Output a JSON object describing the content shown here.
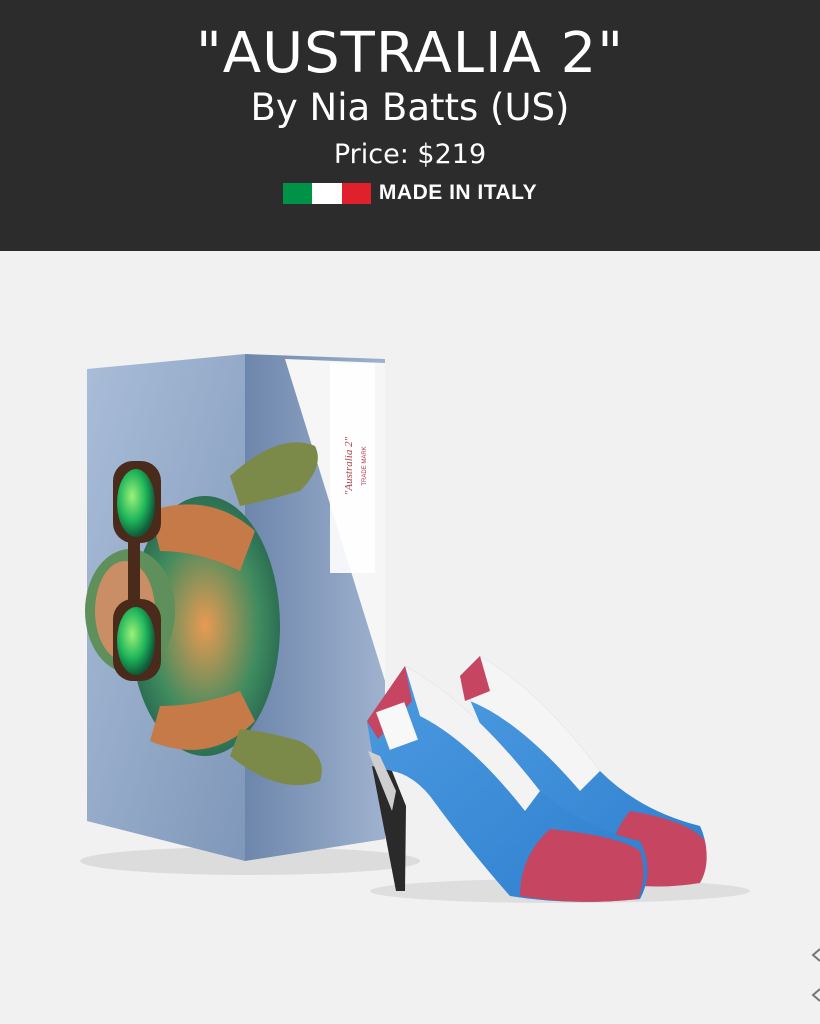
{
  "header": {
    "title": "\"AUSTRALIA 2\"",
    "designer": "By Nia Batts (US)",
    "price": "Price: $219",
    "made_in": "MADE IN ITALY",
    "flag_colors": [
      "#009246",
      "#ffffff",
      "#e0202a"
    ]
  },
  "colors": {
    "header_bg": "#2c2c2c",
    "page_bg": "#f1f1f1",
    "box_blue": "#8fa6c6",
    "shoe_blue": "#3f8fd8",
    "shoe_red": "#c64561"
  },
  "box_label": {
    "brand": "\"Australia 2\"",
    "trademark": "TRADE MARK"
  },
  "icons": {
    "next": "chevron-right-icon",
    "prev": "chevron-left-icon"
  }
}
